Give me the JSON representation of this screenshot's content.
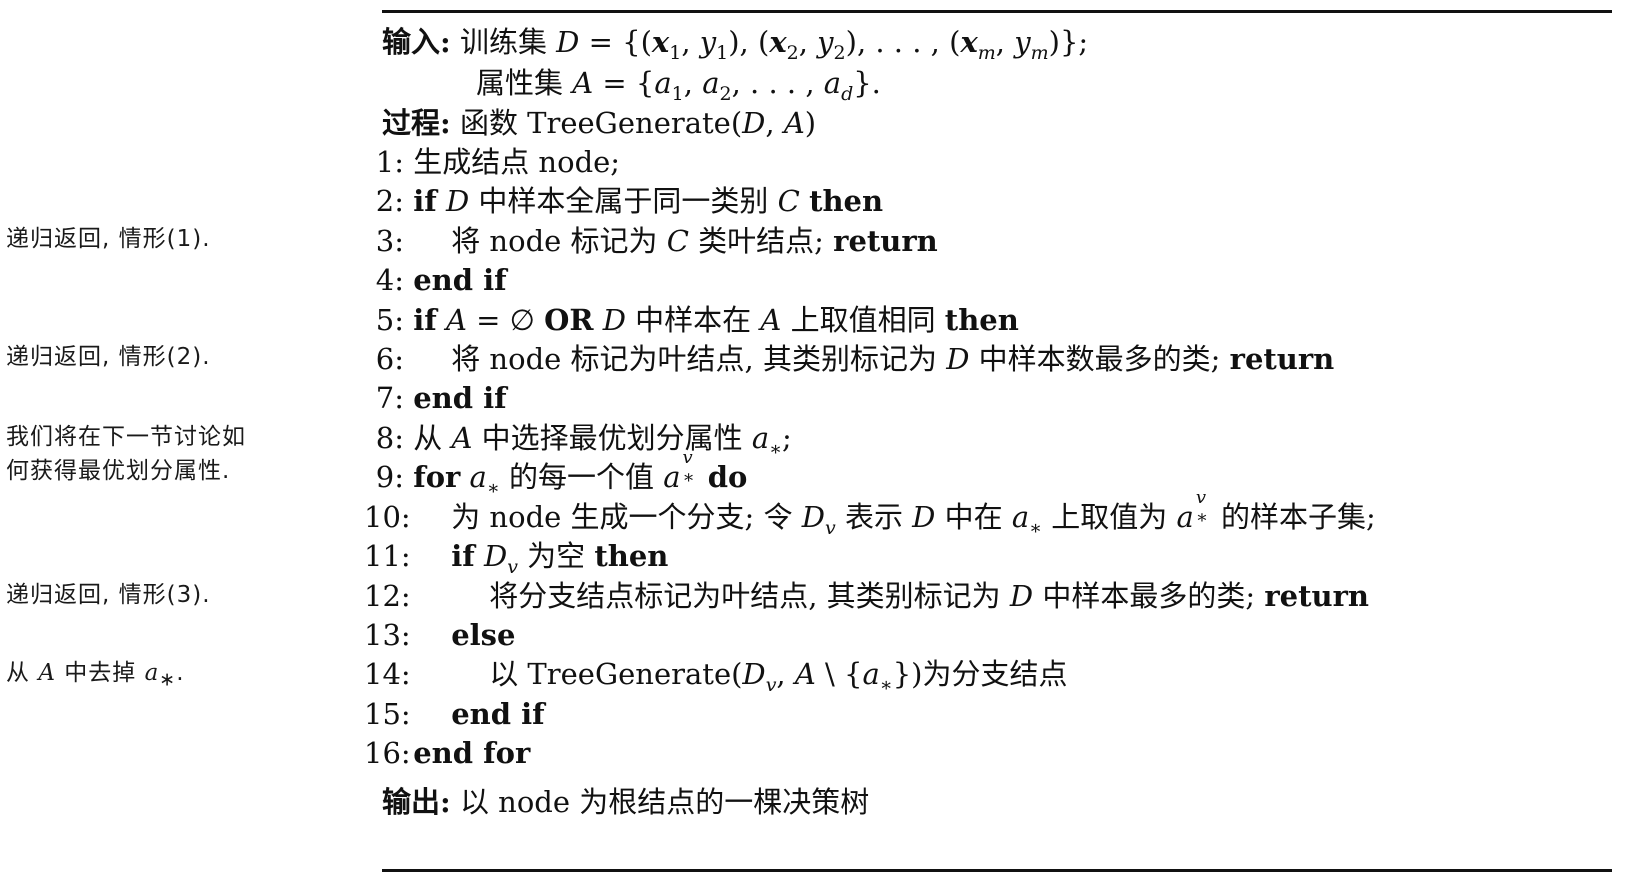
{
  "notes": [
    {
      "text": "递归返回, 情形(1)."
    },
    {
      "text": "递归返回, 情形(2)."
    },
    {
      "line1": "我们将在下一节讨论如",
      "line2": "何获得最优划分属性."
    },
    {
      "text": "递归返回, 情形(3)."
    },
    {
      "pre": "从 ",
      "var": "A",
      "mid": " 中去掉 ",
      "var2": "a",
      "sub": "∗",
      "post": "."
    }
  ],
  "algo": {
    "input_label": "输入:",
    "input_line1": {
      "pre": "训练集 ",
      "D": "D",
      "eq": " = {(",
      "x1": "x",
      "s1": "1",
      "c1": ", ",
      "y1": "y",
      "ys1": "1",
      "p1": "), (",
      "x2": "x",
      "s2": "2",
      "c2": ", ",
      "y2": "y",
      "ys2": "2",
      "p2": "), . . . , (",
      "xm": "x",
      "sm": "m",
      "c3": ", ",
      "ym": "y",
      "ysm": "m",
      "p3": ")};"
    },
    "input_line2": {
      "pre": "属性集 ",
      "A": "A",
      "eq": " = {",
      "a1": "a",
      "s1": "1",
      "c1": ", ",
      "a2": "a",
      "s2": "2",
      "c2": ", . . . , ",
      "ad": "a",
      "sd": "d",
      "post": "}."
    },
    "proc_label": "过程:",
    "proc_line": {
      "pre": "函数 TreeGenerate(",
      "D": "D",
      "mid": ", ",
      "A": "A",
      "post": ")"
    },
    "output_label": "输出:",
    "output_text": "以 node 为根结点的一棵决策树",
    "lines": [
      {
        "num": "1:",
        "text": "生成结点 node;"
      },
      {
        "num": "2:",
        "kw1": "if",
        "sp1": " ",
        "D": "D",
        "mid": " 中样本全属于同一类别 ",
        "C": "C",
        "sp2": "  ",
        "kw2": "then"
      },
      {
        "num": "3:",
        "pre": "将 node 标记为 ",
        "C": "C",
        "mid": " 类叶结点; ",
        "kw": "return"
      },
      {
        "num": "4:",
        "kw": "end if"
      },
      {
        "num": "5:",
        "kw1": "if",
        "sp1": " ",
        "A": "A",
        "eq": " = ∅  ",
        "kw2": "OR",
        "sp2": " ",
        "D": "D",
        "mid": " 中样本在 ",
        "A2": "A",
        "mid2": " 上取值相同 ",
        "kw3": "then"
      },
      {
        "num": "6:",
        "pre": "将 node 标记为叶结点, 其类别标记为 ",
        "D": "D",
        "mid": " 中样本数最多的类; ",
        "kw": "return"
      },
      {
        "num": "7:",
        "kw": "end if"
      },
      {
        "num": "8:",
        "pre": "从 ",
        "A": "A",
        "mid": " 中选择最优划分属性 ",
        "a": "a",
        "sub": "∗",
        "post": ";"
      },
      {
        "num": "9:",
        "kw1": "for",
        "sp1": " ",
        "a": "a",
        "sub": "∗",
        "mid": " 的每一个值 ",
        "a2": "a",
        "sup": "v",
        "sub2": "∗",
        "sp2": " ",
        "kw2": "do"
      },
      {
        "num": "10:",
        "pre": "为 node 生成一个分支; 令 ",
        "D": "D",
        "sub": "v",
        "mid": " 表示 ",
        "D2": "D",
        "mid2": " 中在 ",
        "a": "a",
        "sub2": "∗",
        "mid3": " 上取值为 ",
        "a2": "a",
        "sup": "v",
        "sub3": "∗",
        "post": " 的样本子集;"
      },
      {
        "num": "11:",
        "kw1": "if",
        "sp1": " ",
        "D": "D",
        "sub": "v",
        "mid": " 为空 ",
        "kw2": "then"
      },
      {
        "num": "12:",
        "pre": "将分支结点标记为叶结点, 其类别标记为 ",
        "D": "D",
        "mid": " 中样本最多的类; ",
        "kw": "return"
      },
      {
        "num": "13:",
        "kw": "else"
      },
      {
        "num": "14:",
        "pre": "以 TreeGenerate(",
        "D": "D",
        "sub": "v",
        "mid": ", ",
        "A": "A",
        "mid2": " \\ {",
        "a": "a",
        "sub2": "∗",
        "post": "})为分支结点"
      },
      {
        "num": "15:",
        "kw": "end if"
      },
      {
        "num": "16:",
        "kw": "end for"
      }
    ]
  }
}
